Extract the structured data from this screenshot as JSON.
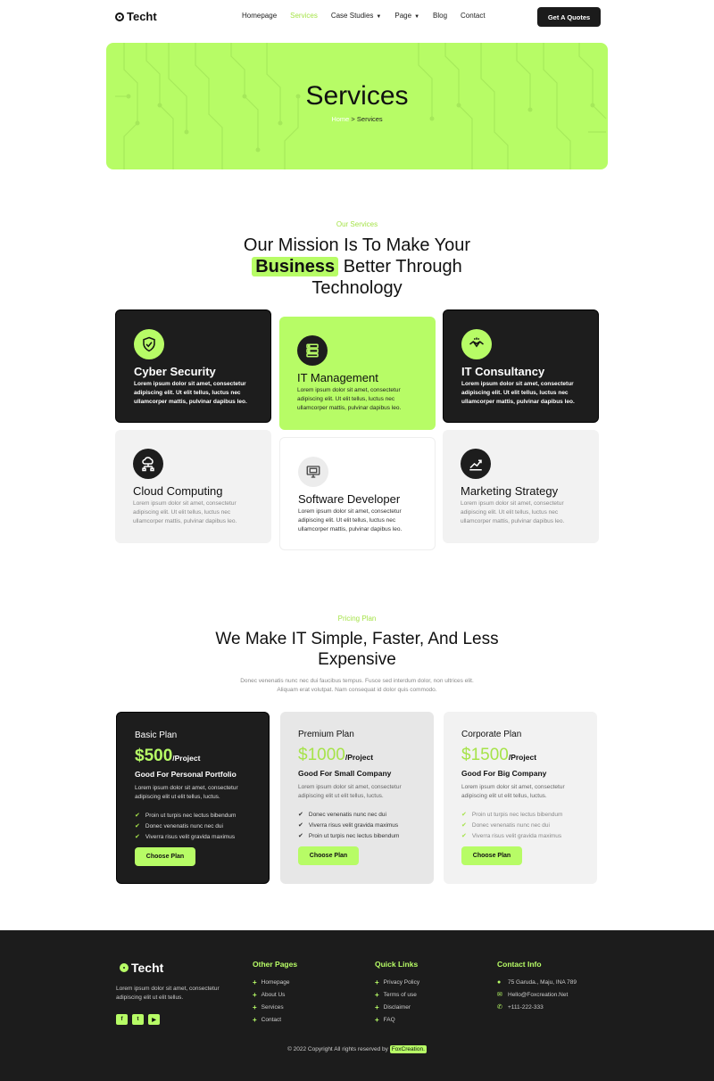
{
  "header": {
    "logo": "Techt",
    "nav": [
      {
        "label": "Homepage",
        "active": false,
        "dropdown": false
      },
      {
        "label": "Services",
        "active": true,
        "dropdown": false
      },
      {
        "label": "Case Studies",
        "active": false,
        "dropdown": true
      },
      {
        "label": "Page",
        "active": false,
        "dropdown": true
      },
      {
        "label": "Blog",
        "active": false,
        "dropdown": false
      },
      {
        "label": "Contact",
        "active": false,
        "dropdown": false
      }
    ],
    "cta": "Get A Quotes"
  },
  "hero": {
    "title": "Services",
    "breadcrumb_home": "Home",
    "breadcrumb_sep": " > ",
    "breadcrumb_current": "Services"
  },
  "services_section": {
    "eyebrow": "Our Services",
    "title_line1": "Our Mission Is To Make Your",
    "title_highlight": "Business",
    "title_line2_rest": "Better Through",
    "title_line3": "Technology",
    "cards": [
      {
        "title": "Cyber Security",
        "text": "Lorem ipsum dolor sit amet, consectetur adipiscing elit. Ut elit tellus, luctus nec ullamcorper mattis, pulvinar dapibus leo.",
        "icon": "shield-icon"
      },
      {
        "title": "IT Management",
        "text": "Lorem ipsum dolor sit amet, consectetur adipiscing elit. Ut elit tellus, luctus nec ullamcorper mattis, pulvinar dapibus leo.",
        "icon": "server-icon"
      },
      {
        "title": "IT Consultancy",
        "text": "Lorem ipsum dolor sit amet, consectetur adipiscing elit. Ut elit tellus, luctus nec ullamcorper mattis, pulvinar dapibus leo.",
        "icon": "handshake-icon"
      },
      {
        "title": "Cloud Computing",
        "text": "Lorem ipsum dolor sit amet, consectetur adipiscing elit. Ut elit tellus, luctus nec ullamcorper mattis, pulvinar dapibus leo.",
        "icon": "cloud-network-icon"
      },
      {
        "title": "Software Developer",
        "text": "Lorem ipsum dolor sit amet, consectetur adipiscing elit. Ut elit tellus, luctus nec ullamcorper mattis, pulvinar dapibus leo.",
        "icon": "monitor-icon"
      },
      {
        "title": "Marketing Strategy",
        "text": "Lorem ipsum dolor sit amet, consectetur adipiscing elit. Ut elit tellus, luctus nec ullamcorper mattis, pulvinar dapibus leo.",
        "icon": "chart-growth-icon"
      }
    ]
  },
  "pricing_section": {
    "eyebrow": "Pricing Plan",
    "title_line1": "We Make IT Simple, Faster, And Less",
    "title_line2": "Expensive",
    "desc_line1": "Donec venenatis nunc nec dui faucibus tempus. Fusce sed interdum dolor, non ultrices elit.",
    "desc_line2": "Aliquam erat volutpat. Nam consequat id dolor quis commodo.",
    "plans": [
      {
        "name": "Basic Plan",
        "price": "$500",
        "unit": "/Project",
        "subtitle": "Good For Personal Portfolio",
        "text": "Lorem ipsum dolor sit amet, consectetur adipiscing elit ut elit tellus, luctus.",
        "features": [
          "Proin ut turpis nec lectus bibendum",
          "Donec venenatis nunc nec dui",
          "Viverra risus velit gravida maximus"
        ],
        "button": "Choose Plan"
      },
      {
        "name": "Premium Plan",
        "price": "$1000",
        "unit": "/Project",
        "subtitle": "Good For Small Company",
        "text": "Lorem ipsum dolor sit amet, consectetur adipiscing elit ut elit tellus, luctus.",
        "features": [
          "Donec venenatis nunc nec dui",
          "Viverra risus velit gravida maximus",
          "Proin ut turpis nec lectus bibendum"
        ],
        "button": "Choose Plan"
      },
      {
        "name": "Corporate Plan",
        "price": "$1500",
        "unit": "/Project",
        "subtitle": "Good For Big Company",
        "text": "Lorem ipsum dolor sit amet, consectetur adipiscing elit ut elit tellus, luctus.",
        "features": [
          "Proin ut turpis nec lectus bibendum",
          "Donec venenatis nunc nec dui",
          "Viverra risus velit gravida maximus"
        ],
        "button": "Choose Plan"
      }
    ]
  },
  "footer": {
    "logo": "Techt",
    "desc": "Lorem ipsum dolor sit amet, consectetur adipiscing elit ut elit tellus.",
    "socials": [
      "facebook-icon",
      "twitter-icon",
      "youtube-icon"
    ],
    "other_pages": {
      "title": "Other Pages",
      "items": [
        "Homepage",
        "About Us",
        "Services",
        "Contact"
      ]
    },
    "quick_links": {
      "title": "Quick Links",
      "items": [
        "Privacy Policy",
        "Terms of use",
        "Disclaimer",
        "FAQ"
      ]
    },
    "contact": {
      "title": "Contact Info",
      "address": "75 Garuda., Maju, INA 789",
      "email": "Hello@Foxcreation.Net",
      "phone": "+111-222-333"
    },
    "copyright": "© 2022 Copyright All rights reserved by",
    "brand": "FoxCreation."
  },
  "colors": {
    "accent": "#b7fc66",
    "dark": "#1d1d1d",
    "light": "#f2f2f2"
  }
}
